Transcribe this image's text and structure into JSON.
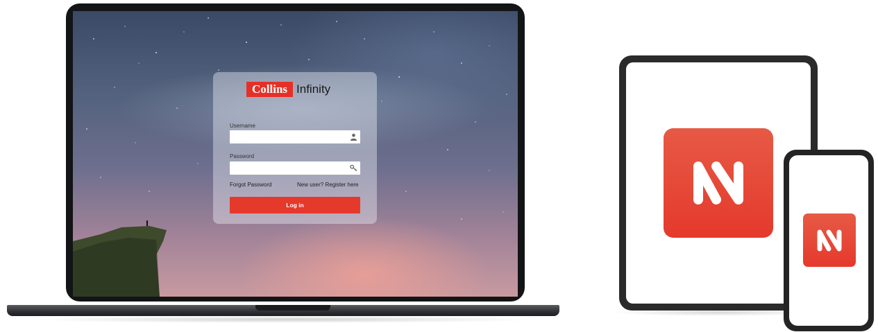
{
  "login": {
    "brand": "Collins",
    "product": "Infinity",
    "username_label": "Username",
    "username_value": "",
    "password_label": "Password",
    "password_value": "",
    "forgot_password": "Forgot Password",
    "new_user_prompt": "New user?",
    "register_link": "Register here",
    "login_button": "Log in"
  },
  "icons": {
    "username_field": "user-icon",
    "password_field": "key-icon",
    "app": "collins-infinity-app-icon"
  },
  "colors": {
    "brand_red": "#e5392c",
    "device_frame": "#131415"
  }
}
